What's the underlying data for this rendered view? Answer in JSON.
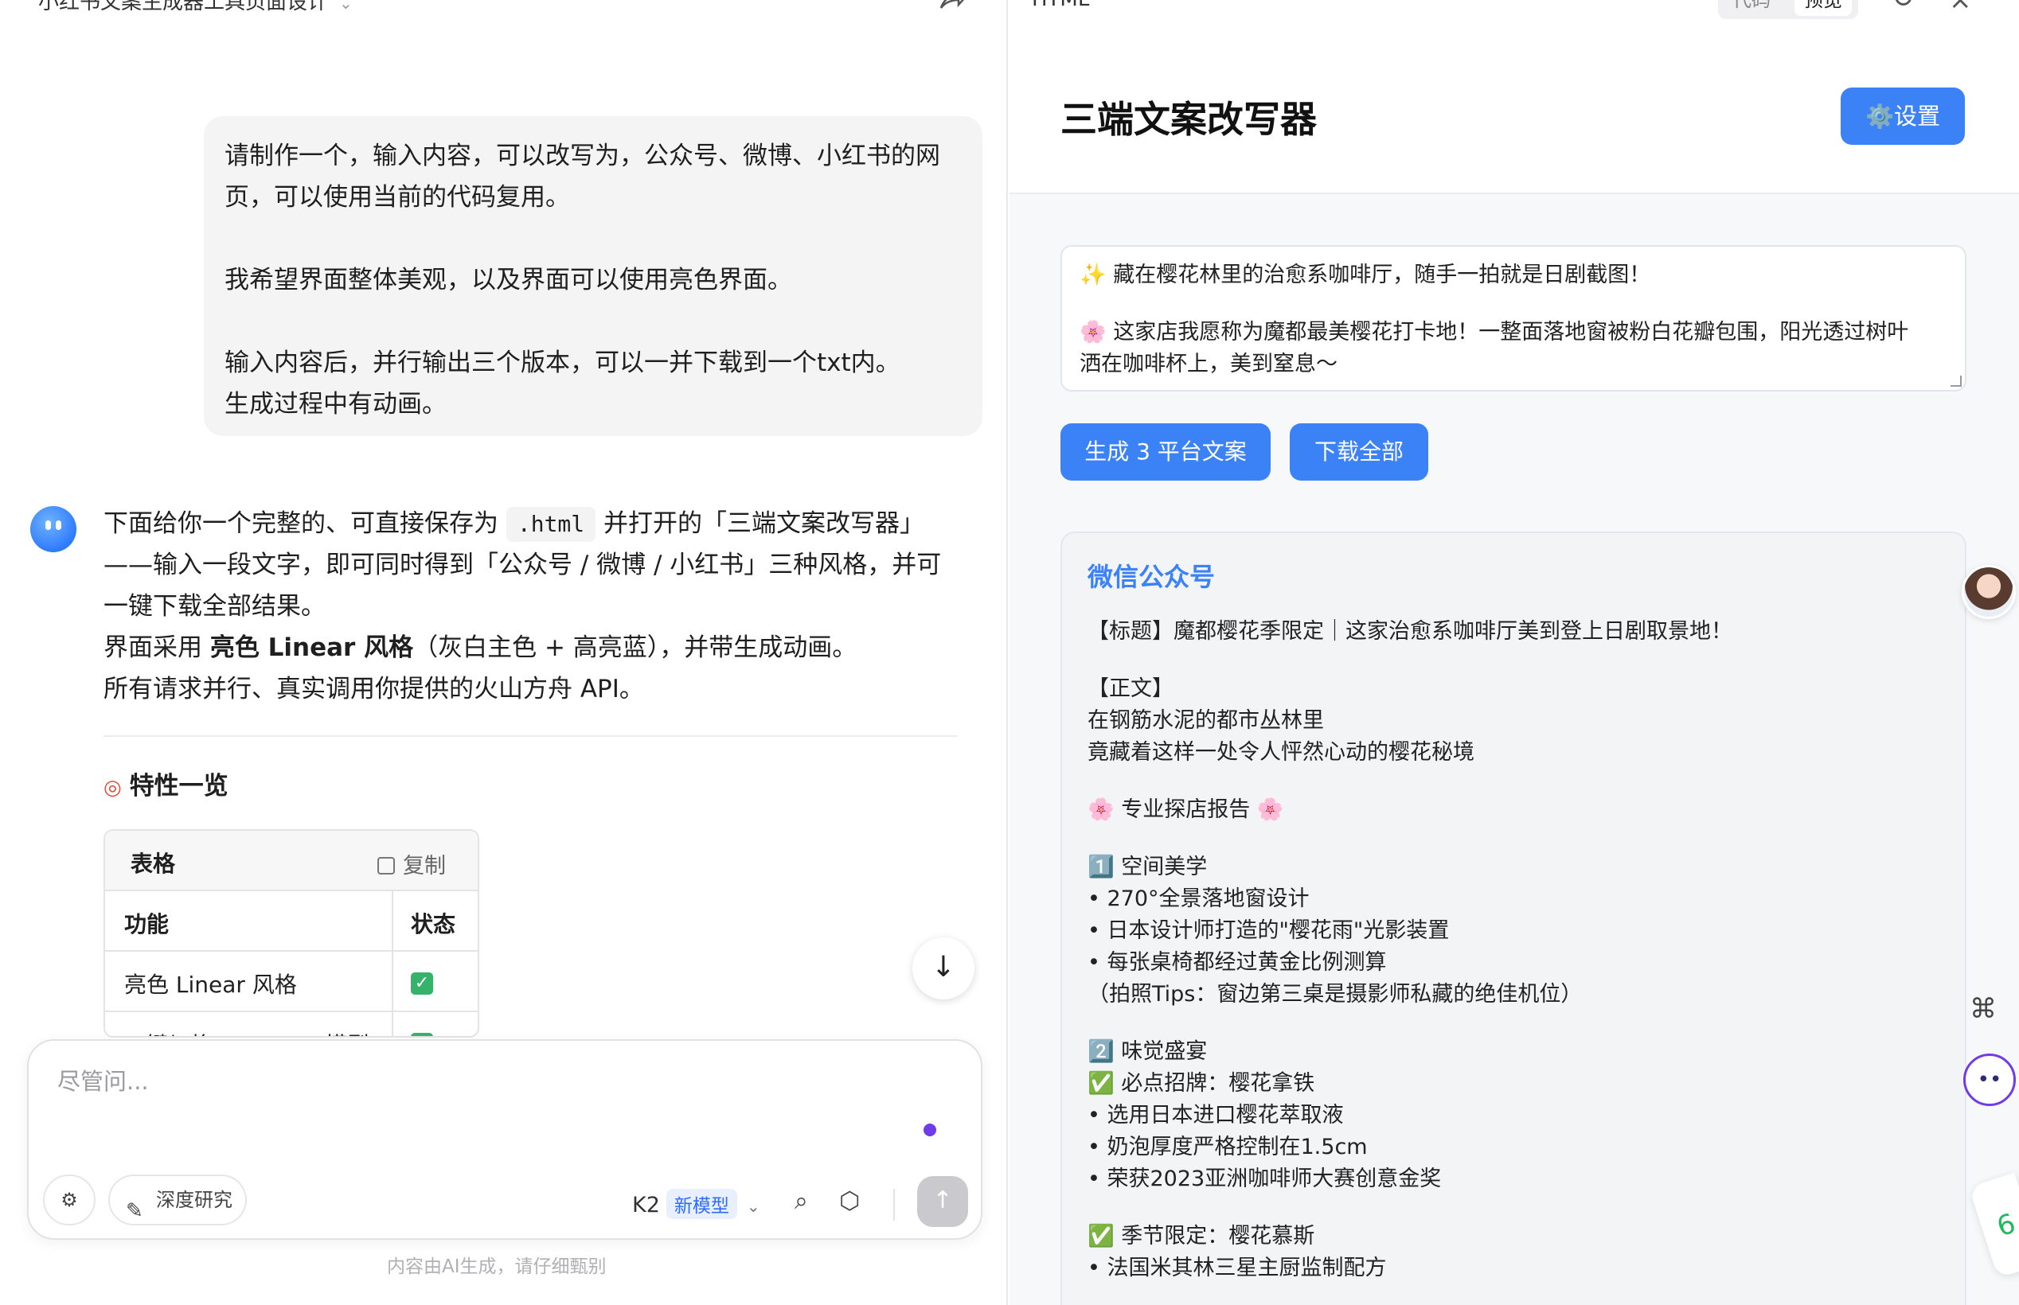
{
  "chat": {
    "title": "小红书文案生成器工具页面设计",
    "user_message": {
      "lines_1": [
        "请制作一个，输入内容，可以改写为，公众号、微博、小红书的网",
        "页，可以使用当前的代码复用。"
      ],
      "line_2": "我希望界面整体美观，以及界面可以使用亮色界面。",
      "lines_3": [
        "输入内容后，并行输出三个版本，可以一并下载到一个txt内。",
        "生成过程中有动画。"
      ]
    },
    "bot_message": {
      "p1_before": "下面给你一个完整的、可直接保存为",
      "p1_code": ".html",
      "p1_after": "并打开的「三端文案改写器」",
      "p2": "——输入一段文字，即可同时得到「公众号 / 微博 / 小红书」三种风格，并可",
      "p3": "一键下载全部结果。",
      "p4_before": "界面采用",
      "p4_bold": "亮色 Linear 风格",
      "p4_after": "（灰白主色 + 高亮蓝），并带生成动画。",
      "p5": "所有请求并行、真实调用你提供的火山方舟 API。"
    },
    "features_title": "特性一览",
    "table": {
      "label": "表格",
      "copy": "复制",
      "headers": [
        "功能",
        "状态"
      ],
      "rows": [
        {
          "feature": "亮色 Linear 风格",
          "status": "✓"
        },
        {
          "feature": "一键切换 API Key / 模型",
          "status": "✓"
        }
      ]
    },
    "input": {
      "placeholder": "尽管问...",
      "deep_research": "深度研究",
      "model_name": "K2",
      "model_tag": "新模型"
    },
    "disclaimer": "内容由AI生成，请仔细甄别"
  },
  "preview": {
    "panel_label": "HTML",
    "tabs": [
      "代码",
      "预览"
    ],
    "app_title": "三端文案改写器",
    "settings_label": "⚙️设置",
    "textarea_lines": [
      "✨ 藏在樱花林里的治愈系咖啡厅，随手一拍就是日剧截图！",
      "🌸 这家店我愿称为魔都最美樱花打卡地！一整面落地窗被粉白花瓣包围，阳光透过树叶",
      "洒在咖啡杯上，美到窒息～"
    ],
    "generate_label": "生成 3 平台文案",
    "download_label": "下载全部",
    "card_title": "微信公众号",
    "card_lines": [
      "【标题】魔都樱花季限定｜这家治愈系咖啡厅美到登上日剧取景地！",
      "",
      "【正文】",
      "在钢筋水泥的都市丛林里",
      "竟藏着这样一处令人怦然心动的樱花秘境",
      "",
      "🌸 专业探店报告 🌸",
      "",
      "1️⃣ 空间美学",
      "• 270°全景落地窗设计",
      "• 日本设计师打造的\"樱花雨\"光影装置",
      "• 每张桌椅都经过黄金比例测算",
      "（拍照Tips：窗边第三桌是摄影师私藏的绝佳机位）",
      "",
      "2️⃣ 味觉盛宴",
      "✅ 必点招牌：樱花拿铁",
      "• 选用日本进口樱花萃取液",
      "• 奶泡厚度严格控制在1.5cm",
      "• 荣获2023亚洲咖啡师大赛创意金奖",
      "",
      "✅ 季节限定：樱花慕斯",
      "• 法国米其林三星主厨监制配方"
    ]
  },
  "colors": {
    "accent": "#3b82f6",
    "purple": "#6f3ce8",
    "check_green": "#35b36a"
  }
}
